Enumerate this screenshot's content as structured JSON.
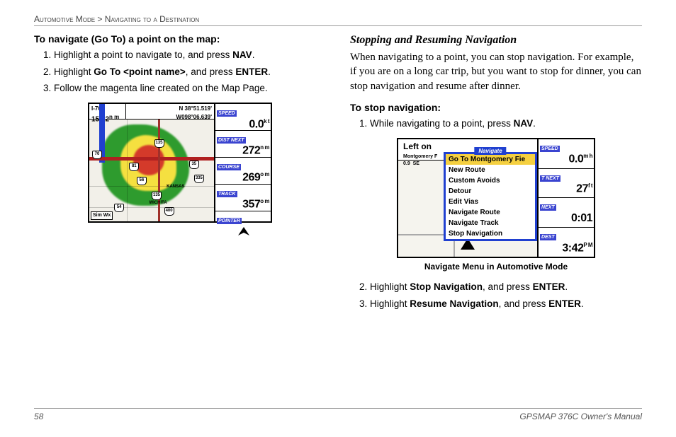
{
  "breadcrumb": {
    "section": "Automotive Mode",
    "sep": " > ",
    "sub": "Navigating to a Destination"
  },
  "left": {
    "heading": "To navigate (Go To) a point on the map:",
    "steps": [
      {
        "pre": "Highlight a point to navigate to, and press ",
        "b1": "NAV",
        "post": "."
      },
      {
        "pre": "Highlight ",
        "b1": "Go To <point name>",
        "mid": ", and press ",
        "b2": "ENTER",
        "post": "."
      },
      {
        "pre": "Follow the magenta line created on the Map Page."
      }
    ],
    "device": {
      "top_left_a": "I-70",
      "top_left_b": "155.2",
      "top_left_unit": "n m",
      "top_right_a": "N  38°51.519'",
      "top_right_b": "W098°06.639'",
      "rows": [
        {
          "label": "SPEED",
          "val": "0.0",
          "unit": "k t"
        },
        {
          "label": "DIST NEXT",
          "val": "272",
          "unit": "n m"
        },
        {
          "label": "COURSE",
          "val": "269",
          "unit": "o m"
        },
        {
          "label": "TRACK",
          "val": "357",
          "unit": "o m"
        },
        {
          "label": "POINTER",
          "val": "",
          "unit": ""
        }
      ],
      "simwx": "Sim Wx",
      "shields": {
        "i70": "70",
        "i135": "135",
        "us56": "56",
        "i35": "35",
        "i335": "335",
        "us400": "400",
        "i135b": "135",
        "us54": "54",
        "us81": "81"
      },
      "labels": {
        "kansas": "KANSAS",
        "wichita": "WICHITA"
      }
    }
  },
  "right": {
    "section_heading": "Stopping and Resuming Navigation",
    "body": "When navigating to a point, you can stop navigation. For example, if you are on a long car trip, but you want to stop for dinner, you can stop navigation and resume after dinner.",
    "sub_heading": "To stop navigation:",
    "step1": {
      "pre": "While navigating to a point, press ",
      "b1": "NAV",
      "post": "."
    },
    "device": {
      "top_left": "Left on",
      "top_sub_a": "Montgomery F",
      "top_sub_b": "0.9",
      "top_sub_c": "SE",
      "menu_title": "Navigate",
      "menu": [
        "Go To Montgomery Fie",
        "New Route",
        "Custom Avoids",
        "Detour",
        "Edit Vias",
        "Navigate Route",
        "Navigate Track",
        "Stop Navigation"
      ],
      "rows": [
        {
          "label": "SPEED",
          "val": "0.0",
          "unit": "m h"
        },
        {
          "label": "T NEXT",
          "val": "27",
          "unit": "f t"
        },
        {
          "label": "NEXT",
          "val": "0:01",
          "unit": ""
        },
        {
          "label": "DEST",
          "val": "3:42",
          "unit": "P M"
        }
      ]
    },
    "caption": "Navigate Menu in Automotive Mode",
    "step2": {
      "pre": "Highlight ",
      "b1": "Stop Navigation",
      "mid": ", and press ",
      "b2": "ENTER",
      "post": "."
    },
    "step3": {
      "pre": "Highlight ",
      "b1": "Resume Navigation",
      "mid": ", and press ",
      "b2": "ENTER",
      "post": "."
    }
  },
  "footer": {
    "page": "58",
    "manual": "GPSMAP 376C Owner's Manual"
  }
}
